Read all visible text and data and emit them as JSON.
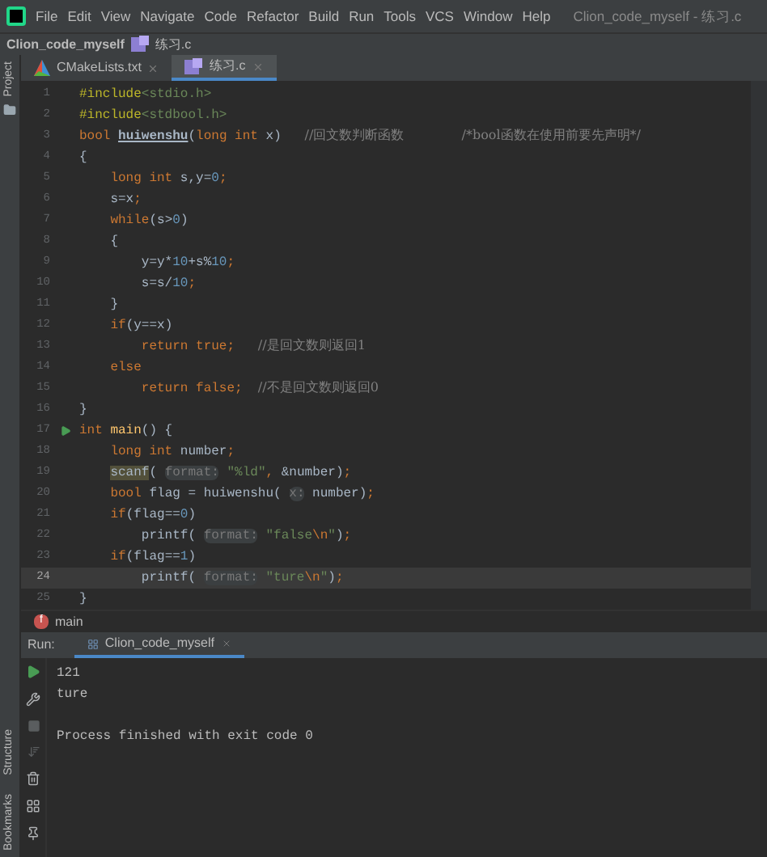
{
  "menu": {
    "items": [
      "File",
      "Edit",
      "View",
      "Navigate",
      "Code",
      "Refactor",
      "Build",
      "Run",
      "Tools",
      "VCS",
      "Window",
      "Help"
    ],
    "title": "Clion_code_myself - 练习.c"
  },
  "breadcrumb": {
    "project": "Clion_code_myself",
    "file": "练习.c"
  },
  "tool_stripe": {
    "top": "Project",
    "bottom": [
      "Structure",
      "Bookmarks"
    ]
  },
  "tabs": [
    {
      "label": "CMakeLists.txt",
      "kind": "cmake",
      "selected": false
    },
    {
      "label": "练习.c",
      "kind": "c",
      "selected": true
    }
  ],
  "code": [
    {
      "number": "1",
      "current": false,
      "run_marker": false,
      "tokens": [
        {
          "kind": "directive",
          "text": "#include"
        },
        {
          "kind": "header",
          "text": "<stdio.h>"
        }
      ]
    },
    {
      "number": "2",
      "current": false,
      "run_marker": false,
      "tokens": [
        {
          "kind": "directive",
          "text": "#include"
        },
        {
          "kind": "header",
          "text": "<stdbool.h>"
        }
      ]
    },
    {
      "number": "3",
      "current": false,
      "run_marker": false,
      "tokens": [
        {
          "kind": "keyword",
          "text": "bool "
        },
        {
          "kind": "decl",
          "text": "huiwenshu"
        },
        {
          "kind": "plain",
          "text": "("
        },
        {
          "kind": "keyword",
          "text": "long int "
        },
        {
          "kind": "plain",
          "text": "x)   "
        },
        {
          "kind": "comment",
          "text": "//回文数判断函数              "
        },
        {
          "kind": "comment",
          "text": "/*bool函数在使用前要先声明*/"
        }
      ]
    },
    {
      "number": "4",
      "current": false,
      "run_marker": false,
      "tokens": [
        {
          "kind": "plain",
          "text": "{"
        }
      ]
    },
    {
      "number": "5",
      "current": false,
      "run_marker": false,
      "tokens": [
        {
          "kind": "keyword",
          "text": "    long int "
        },
        {
          "kind": "plain",
          "text": "s,y="
        },
        {
          "kind": "number",
          "text": "0"
        },
        {
          "kind": "keyword",
          "text": ";"
        }
      ]
    },
    {
      "number": "6",
      "current": false,
      "run_marker": false,
      "tokens": [
        {
          "kind": "plain",
          "text": "    s=x"
        },
        {
          "kind": "keyword",
          "text": ";"
        }
      ]
    },
    {
      "number": "7",
      "current": false,
      "run_marker": false,
      "tokens": [
        {
          "kind": "keyword",
          "text": "    while"
        },
        {
          "kind": "plain",
          "text": "(s>"
        },
        {
          "kind": "number",
          "text": "0"
        },
        {
          "kind": "plain",
          "text": ")"
        }
      ]
    },
    {
      "number": "8",
      "current": false,
      "run_marker": false,
      "tokens": [
        {
          "kind": "plain",
          "text": "    {"
        }
      ]
    },
    {
      "number": "9",
      "current": false,
      "run_marker": false,
      "tokens": [
        {
          "kind": "plain",
          "text": "        y=y*"
        },
        {
          "kind": "number",
          "text": "10"
        },
        {
          "kind": "plain",
          "text": "+s%"
        },
        {
          "kind": "number",
          "text": "10"
        },
        {
          "kind": "keyword",
          "text": ";"
        }
      ]
    },
    {
      "number": "10",
      "current": false,
      "run_marker": false,
      "tokens": [
        {
          "kind": "plain",
          "text": "        s=s/"
        },
        {
          "kind": "number",
          "text": "10"
        },
        {
          "kind": "keyword",
          "text": ";"
        }
      ]
    },
    {
      "number": "11",
      "current": false,
      "run_marker": false,
      "tokens": [
        {
          "kind": "plain",
          "text": "    }"
        }
      ]
    },
    {
      "number": "12",
      "current": false,
      "run_marker": false,
      "tokens": [
        {
          "kind": "keyword",
          "text": "    if"
        },
        {
          "kind": "plain",
          "text": "(y==x)"
        }
      ]
    },
    {
      "number": "13",
      "current": false,
      "run_marker": false,
      "tokens": [
        {
          "kind": "keyword",
          "text": "        return true;   "
        },
        {
          "kind": "comment",
          "text": "//是回文数则返回1"
        }
      ]
    },
    {
      "number": "14",
      "current": false,
      "run_marker": false,
      "tokens": [
        {
          "kind": "keyword",
          "text": "    else"
        }
      ]
    },
    {
      "number": "15",
      "current": false,
      "run_marker": false,
      "tokens": [
        {
          "kind": "keyword",
          "text": "        return false;  "
        },
        {
          "kind": "comment",
          "text": "//不是回文数则返回0"
        }
      ]
    },
    {
      "number": "16",
      "current": false,
      "run_marker": false,
      "tokens": [
        {
          "kind": "plain",
          "text": "}"
        }
      ]
    },
    {
      "number": "17",
      "current": false,
      "run_marker": true,
      "tokens": [
        {
          "kind": "keyword",
          "text": "int "
        },
        {
          "kind": "function",
          "text": "main"
        },
        {
          "kind": "plain",
          "text": "() {"
        }
      ]
    },
    {
      "number": "18",
      "current": false,
      "run_marker": false,
      "tokens": [
        {
          "kind": "keyword",
          "text": "    long int "
        },
        {
          "kind": "plain",
          "text": "number"
        },
        {
          "kind": "keyword",
          "text": ";"
        }
      ]
    },
    {
      "number": "19",
      "current": false,
      "run_marker": false,
      "tokens": [
        {
          "kind": "call_highlight",
          "text": "    scanf"
        },
        {
          "kind": "plain",
          "text": "( "
        },
        {
          "kind": "hint",
          "text": "format:"
        },
        {
          "kind": "string",
          "text": " \"%ld\""
        },
        {
          "kind": "keyword",
          "text": ", "
        },
        {
          "kind": "plain",
          "text": "&number)"
        },
        {
          "kind": "keyword",
          "text": ";"
        }
      ]
    },
    {
      "number": "20",
      "current": false,
      "run_marker": false,
      "tokens": [
        {
          "kind": "keyword",
          "text": "    bool "
        },
        {
          "kind": "plain",
          "text": "flag = huiwenshu( "
        },
        {
          "kind": "hint",
          "text": "x:"
        },
        {
          "kind": "plain",
          "text": " number)"
        },
        {
          "kind": "keyword",
          "text": ";"
        }
      ]
    },
    {
      "number": "21",
      "current": false,
      "run_marker": false,
      "tokens": [
        {
          "kind": "keyword",
          "text": "    if"
        },
        {
          "kind": "plain",
          "text": "(flag=="
        },
        {
          "kind": "number",
          "text": "0"
        },
        {
          "kind": "plain",
          "text": ")"
        }
      ]
    },
    {
      "number": "22",
      "current": false,
      "run_marker": false,
      "tokens": [
        {
          "kind": "plain",
          "text": "        printf( "
        },
        {
          "kind": "hint",
          "text": "format:"
        },
        {
          "kind": "string",
          "text": " \"false"
        },
        {
          "kind": "escape",
          "text": "\\n"
        },
        {
          "kind": "string",
          "text": "\""
        },
        {
          "kind": "plain",
          "text": ")"
        },
        {
          "kind": "keyword",
          "text": ";"
        }
      ]
    },
    {
      "number": "23",
      "current": false,
      "run_marker": false,
      "tokens": [
        {
          "kind": "keyword",
          "text": "    if"
        },
        {
          "kind": "plain",
          "text": "(flag=="
        },
        {
          "kind": "number",
          "text": "1"
        },
        {
          "kind": "plain",
          "text": ")"
        }
      ]
    },
    {
      "number": "24",
      "current": true,
      "run_marker": false,
      "tokens": [
        {
          "kind": "plain",
          "text": "        printf( "
        },
        {
          "kind": "hint",
          "text": "format:"
        },
        {
          "kind": "string",
          "text": " \"ture"
        },
        {
          "kind": "escape",
          "text": "\\n"
        },
        {
          "kind": "string",
          "text": "\""
        },
        {
          "kind": "plain",
          "text": ")"
        },
        {
          "kind": "keyword",
          "text": ";"
        }
      ]
    },
    {
      "number": "25",
      "current": false,
      "run_marker": false,
      "tokens": [
        {
          "kind": "plain",
          "text": "}"
        }
      ]
    }
  ],
  "editor_breadcrumb": {
    "badge": "f",
    "label": "main"
  },
  "run_panel": {
    "label": "Run:",
    "tab": {
      "label": "Clion_code_myself",
      "selected": true
    },
    "output": [
      "121",
      "ture"
    ],
    "exit_message": "Process finished with exit code 0"
  }
}
